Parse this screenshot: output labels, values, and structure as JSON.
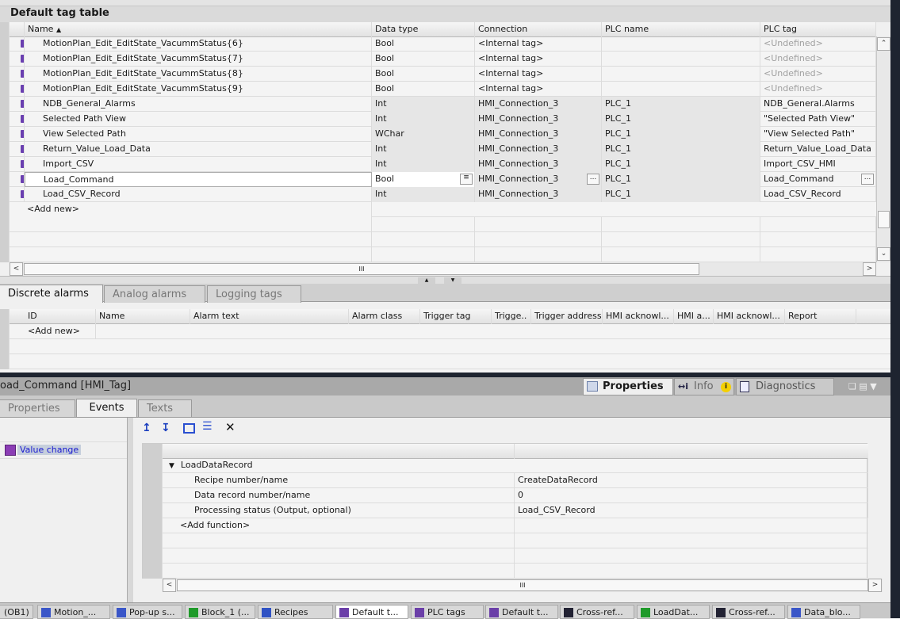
{
  "tag_table": {
    "title": "Default tag table",
    "columns": [
      "Name",
      "Data type",
      "Connection",
      "PLC name",
      "PLC tag"
    ],
    "rows": [
      {
        "name": "MotionPlan_Edit_EditState_VacummStatus{6}",
        "type": "Bool",
        "connection": "<Internal tag>",
        "plc": "",
        "tag": "<Undefined>"
      },
      {
        "name": "MotionPlan_Edit_EditState_VacummStatus{7}",
        "type": "Bool",
        "connection": "<Internal tag>",
        "plc": "",
        "tag": "<Undefined>"
      },
      {
        "name": "MotionPlan_Edit_EditState_VacummStatus{8}",
        "type": "Bool",
        "connection": "<Internal tag>",
        "plc": "",
        "tag": "<Undefined>"
      },
      {
        "name": "MotionPlan_Edit_EditState_VacummStatus{9}",
        "type": "Bool",
        "connection": "<Internal tag>",
        "plc": "",
        "tag": "<Undefined>"
      },
      {
        "name": "NDB_General_Alarms",
        "type": "Int",
        "connection": "HMI_Connection_3",
        "plc": "PLC_1",
        "tag": "NDB_General.Alarms"
      },
      {
        "name": "Selected Path View",
        "type": "Int",
        "connection": "HMI_Connection_3",
        "plc": "PLC_1",
        "tag": "\"Selected Path View\""
      },
      {
        "name": "View Selected Path",
        "type": "WChar",
        "connection": "HMI_Connection_3",
        "plc": "PLC_1",
        "tag": "\"View Selected Path\""
      },
      {
        "name": "Return_Value_Load_Data",
        "type": "Int",
        "connection": "HMI_Connection_3",
        "plc": "PLC_1",
        "tag": "Return_Value_Load_Data"
      },
      {
        "name": "Import_CSV",
        "type": "Int",
        "connection": "HMI_Connection_3",
        "plc": "PLC_1",
        "tag": "Import_CSV_HMI"
      },
      {
        "name": "Load_Command",
        "type": "Bool",
        "connection": "HMI_Connection_3",
        "plc": "PLC_1",
        "tag": "Load_Command"
      },
      {
        "name": "Load_CSV_Record",
        "type": "Int",
        "connection": "HMI_Connection_3",
        "plc": "PLC_1",
        "tag": "Load_CSV_Record"
      }
    ],
    "add_new": "<Add new>",
    "ellipsis": "...",
    "scroll_grip": "III"
  },
  "alarm_tabs": [
    "Discrete alarms",
    "Analog alarms",
    "Logging tags"
  ],
  "alarm_columns": [
    "ID",
    "Name",
    "Alarm text",
    "Alarm class",
    "Trigger tag",
    "Trigge..",
    "Trigger address",
    "HMI acknowl...",
    "HMI a...",
    "HMI acknowl...",
    "Report"
  ],
  "alarm_add_new": "<Add new>",
  "inspector": {
    "title": "oad_Command [HMI_Tag]",
    "right_tabs": [
      "Properties",
      "Info",
      "Diagnostics"
    ],
    "tabs": [
      "Properties",
      "Events",
      "Texts"
    ],
    "event": "Value change",
    "function": "LoadDataRecord",
    "params": [
      {
        "name": "Recipe number/name",
        "value": "CreateDataRecord"
      },
      {
        "name": "Data record number/name",
        "value": "0"
      },
      {
        "name": "Processing status (Output, optional)",
        "value": "Load_CSV_Record"
      }
    ],
    "add_function": "<Add function>"
  },
  "taskbar": [
    "(OB1)",
    "Motion_...",
    "Pop-up s...",
    "Block_1 (...",
    "Recipes",
    "Default t...",
    "PLC tags",
    "Default t...",
    "Cross-ref...",
    "LoadDat...",
    "Cross-ref...",
    "Data_blo..."
  ]
}
